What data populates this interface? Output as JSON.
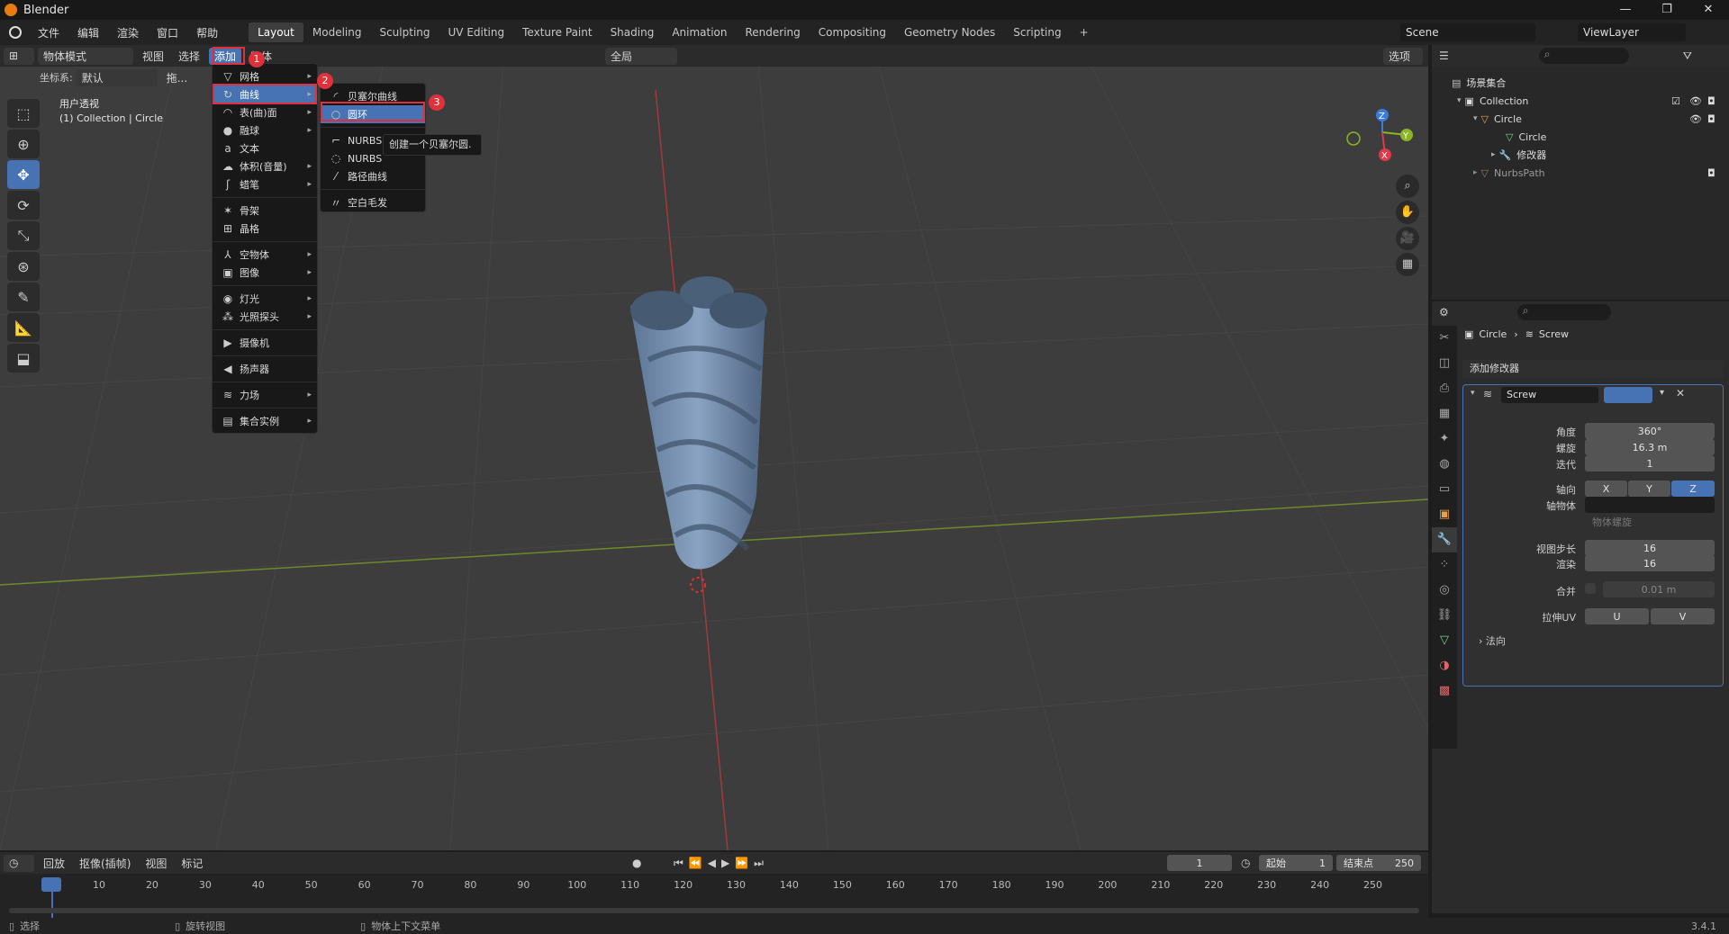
{
  "window": {
    "title": "Blender",
    "controls": [
      "—",
      "❐",
      "✕"
    ]
  },
  "menubar": {
    "menus": [
      "文件",
      "编辑",
      "渲染",
      "窗口",
      "帮助"
    ],
    "workspaces": [
      "Layout",
      "Modeling",
      "Sculpting",
      "UV Editing",
      "Texture Paint",
      "Shading",
      "Animation",
      "Rendering",
      "Compositing",
      "Geometry Nodes",
      "Scripting"
    ],
    "add_workspace": "+",
    "scene": "Scene",
    "viewlayer": "ViewLayer"
  },
  "viewport_header": {
    "mode": "物体模式",
    "menus": [
      "视图",
      "选择",
      "添加",
      "物体"
    ],
    "transform": "全局",
    "coord_label": "坐标系:",
    "coord_value": "默认",
    "drag_label": "拖...",
    "options": "选项"
  },
  "viewport_overlay": {
    "line1": "用户透视",
    "line2": "(1) Collection | Circle"
  },
  "gizmo": {
    "x": "X",
    "y": "Y",
    "z": "Z"
  },
  "add_menu": {
    "items": [
      {
        "label": "网格",
        "icon": "▽",
        "sub": true
      },
      {
        "label": "曲线",
        "icon": "↻",
        "sub": true
      },
      {
        "label": "表(曲)面",
        "icon": "◠",
        "sub": true
      },
      {
        "label": "融球",
        "icon": "●",
        "sub": true
      },
      {
        "label": "文本",
        "icon": "a",
        "sub": false
      },
      {
        "label": "体积(音量)",
        "icon": "☁",
        "sub": true
      },
      {
        "label": "蜡笔",
        "icon": "ʃ",
        "sub": true
      },
      {
        "label": "骨架",
        "icon": "✶",
        "sub": false
      },
      {
        "label": "晶格",
        "icon": "⊞",
        "sub": false
      },
      {
        "label": "空物体",
        "icon": "⅄",
        "sub": true
      },
      {
        "label": "图像",
        "icon": "▣",
        "sub": true
      },
      {
        "label": "灯光",
        "icon": "◉",
        "sub": true
      },
      {
        "label": "光照探头",
        "icon": "⁂",
        "sub": true
      },
      {
        "label": "摄像机",
        "icon": "▶",
        "sub": false
      },
      {
        "label": "扬声器",
        "icon": "◀",
        "sub": false
      },
      {
        "label": "力场",
        "icon": "≋",
        "sub": true
      },
      {
        "label": "集合实例",
        "icon": "▤",
        "sub": true
      }
    ]
  },
  "curve_menu": {
    "items": [
      {
        "label": "贝塞尔曲线",
        "icon": "◜"
      },
      {
        "label": "圆环",
        "icon": "○"
      },
      {
        "label": "NURBS",
        "icon": "⌐"
      },
      {
        "label": "NURBS",
        "icon": "◌"
      },
      {
        "label": "路径曲线",
        "icon": "⁄"
      },
      {
        "label": "空白毛发",
        "icon": "〃"
      }
    ]
  },
  "tooltip": "创建一个贝塞尔圆.",
  "annotations": [
    "1",
    "2",
    "3"
  ],
  "outliner": {
    "root": "场景集合",
    "collection": "Collection",
    "circle_obj": "Circle",
    "circle_data": "Circle",
    "modifiers": "修改器",
    "nurbspath": "NurbsPath"
  },
  "properties": {
    "breadcrumb_obj": "Circle",
    "breadcrumb_mod": "Screw",
    "add_modifier": "添加修改器",
    "modifier_name": "Screw",
    "fields": {
      "angle_label": "角度",
      "angle": "360°",
      "screw_label": "螺旋",
      "screw": "16.3 m",
      "iter_label": "迭代",
      "iter": "1",
      "axis_label": "轴向",
      "axis_x": "X",
      "axis_y": "Y",
      "axis_z": "Z",
      "axisobj_label": "轴物体",
      "objscrew_label": "物体螺旋",
      "steps_label": "视图步长",
      "steps": "16",
      "render_label": "渲染",
      "render": "16",
      "merge_label": "合并",
      "merge": "0.01 m",
      "uv_label": "拉伸UV",
      "uv_u": "U",
      "uv_v": "V",
      "normals": "法向"
    }
  },
  "timeline": {
    "menus": [
      "回放",
      "抠像(插帧)",
      "视图",
      "标记"
    ],
    "current": "1",
    "start_label": "起始",
    "start": "1",
    "end_label": "结束点",
    "end": "250",
    "ticks": [
      "1",
      "10",
      "20",
      "30",
      "40",
      "50",
      "60",
      "70",
      "80",
      "90",
      "100",
      "110",
      "120",
      "130",
      "140",
      "150",
      "160",
      "170",
      "180",
      "190",
      "200",
      "210",
      "220",
      "230",
      "240",
      "250"
    ]
  },
  "statusbar": {
    "select": "选择",
    "rotate": "旋转视图",
    "context": "物体上下文菜单",
    "version": "3.4.1"
  }
}
